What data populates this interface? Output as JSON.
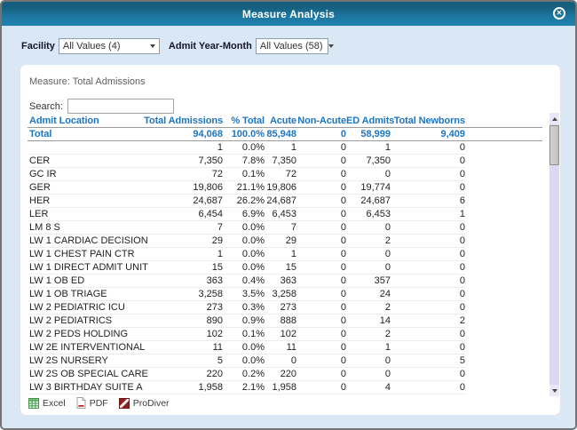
{
  "dialog": {
    "title": "Measure Analysis"
  },
  "filters": {
    "facility": {
      "label": "Facility",
      "value": "All Values (4)"
    },
    "admit_year_month": {
      "label": "Admit Year-Month",
      "value": "All Values (58)"
    }
  },
  "report": {
    "measure_label": "Measure: Total Admissions",
    "search_label": "Search:",
    "search_value": ""
  },
  "table": {
    "columns": [
      "Admit Location",
      "Total Admissions",
      "% Total",
      "Acute",
      "Non-Acute",
      "ED Admits",
      "Total Newborns"
    ],
    "total_row": [
      "Total",
      "94,068",
      "100.0%",
      "85,948",
      "0",
      "58,999",
      "9,409"
    ],
    "rows": [
      [
        "",
        "1",
        "0.0%",
        "1",
        "0",
        "1",
        "0"
      ],
      [
        "CER",
        "7,350",
        "7.8%",
        "7,350",
        "0",
        "7,350",
        "0"
      ],
      [
        "GC IR",
        "72",
        "0.1%",
        "72",
        "0",
        "0",
        "0"
      ],
      [
        "GER",
        "19,806",
        "21.1%",
        "19,806",
        "0",
        "19,774",
        "0"
      ],
      [
        "HER",
        "24,687",
        "26.2%",
        "24,687",
        "0",
        "24,687",
        "6"
      ],
      [
        "LER",
        "6,454",
        "6.9%",
        "6,453",
        "0",
        "6,453",
        "1"
      ],
      [
        "LM 8 S",
        "7",
        "0.0%",
        "7",
        "0",
        "0",
        "0"
      ],
      [
        "LW 1 CARDIAC DECISION",
        "29",
        "0.0%",
        "29",
        "0",
        "2",
        "0"
      ],
      [
        "LW 1 CHEST PAIN CTR",
        "1",
        "0.0%",
        "1",
        "0",
        "0",
        "0"
      ],
      [
        "LW 1 DIRECT ADMIT UNIT",
        "15",
        "0.0%",
        "15",
        "0",
        "0",
        "0"
      ],
      [
        "LW 1 OB ED",
        "363",
        "0.4%",
        "363",
        "0",
        "357",
        "0"
      ],
      [
        "LW 1 OB TRIAGE",
        "3,258",
        "3.5%",
        "3,258",
        "0",
        "24",
        "0"
      ],
      [
        "LW 2 PEDIATRIC ICU",
        "273",
        "0.3%",
        "273",
        "0",
        "2",
        "0"
      ],
      [
        "LW 2 PEDIATRICS",
        "890",
        "0.9%",
        "888",
        "0",
        "14",
        "2"
      ],
      [
        "LW 2 PEDS HOLDING",
        "102",
        "0.1%",
        "102",
        "0",
        "2",
        "0"
      ],
      [
        "LW 2E INTERVENTIONAL",
        "11",
        "0.0%",
        "11",
        "0",
        "1",
        "0"
      ],
      [
        "LW 2S NURSERY",
        "5",
        "0.0%",
        "0",
        "0",
        "0",
        "5"
      ],
      [
        "LW 2S OB SPECIAL CARE",
        "220",
        "0.2%",
        "220",
        "0",
        "0",
        "0"
      ],
      [
        "LW 3 BIRTHDAY SUITE A",
        "1,958",
        "2.1%",
        "1,958",
        "0",
        "4",
        "0"
      ]
    ]
  },
  "export": {
    "excel_label": "Excel",
    "pdf_label": "PDF",
    "prodiver_label": "ProDiver"
  },
  "colors": {
    "titlebar_top": "#145d7c",
    "titlebar_bottom": "#2182ae",
    "body_bg": "#d9e8f4",
    "accent_blue": "#1c76c4",
    "excel_green": "#3f9447",
    "pdf_red": "#cc2222",
    "prodiver_red": "#8e1f1f"
  }
}
